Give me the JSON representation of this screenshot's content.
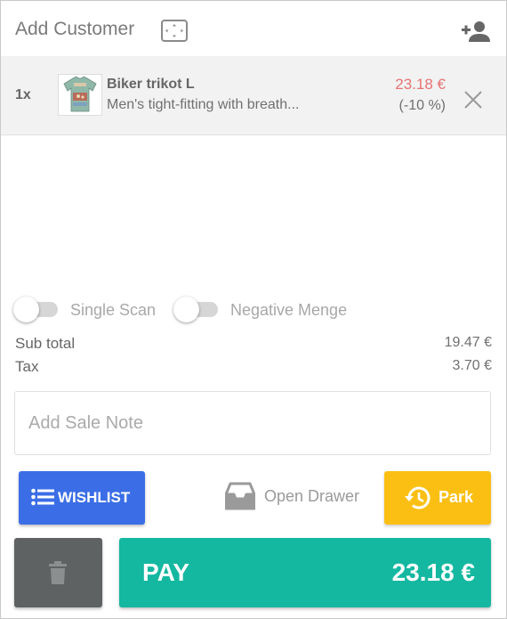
{
  "header": {
    "add_customer_label": "Add Customer",
    "expand_icon": "fullscreen-icon",
    "add_customer_icon": "person-add-icon"
  },
  "cart": {
    "items": [
      {
        "quantity": "1x",
        "name": "Biker trikot L",
        "description": "Men's tight-fitting with breath...",
        "price": "23.18 €",
        "discount": "(-10 %)",
        "remove_icon": "close-icon"
      }
    ]
  },
  "toggles": {
    "single_scan": {
      "label": "Single Scan",
      "on": false
    },
    "negative_menge": {
      "label": "Negative Menge",
      "on": false
    }
  },
  "totals": {
    "subtotal_label": "Sub total",
    "subtotal_value": "19.47 €",
    "tax_label": "Tax",
    "tax_value": "3.70 €"
  },
  "note": {
    "placeholder": "Add Sale Note"
  },
  "actions": {
    "wishlist_label": "WISHLIST",
    "open_drawer_label": "Open Drawer",
    "park_label": "Park",
    "pay_label": "PAY",
    "pay_amount": "23.18 €"
  },
  "colors": {
    "wishlist": "#3b6ee6",
    "park": "#fbbf14",
    "pay": "#14b8a0",
    "trash": "#5f6262",
    "price": "#e57373"
  }
}
